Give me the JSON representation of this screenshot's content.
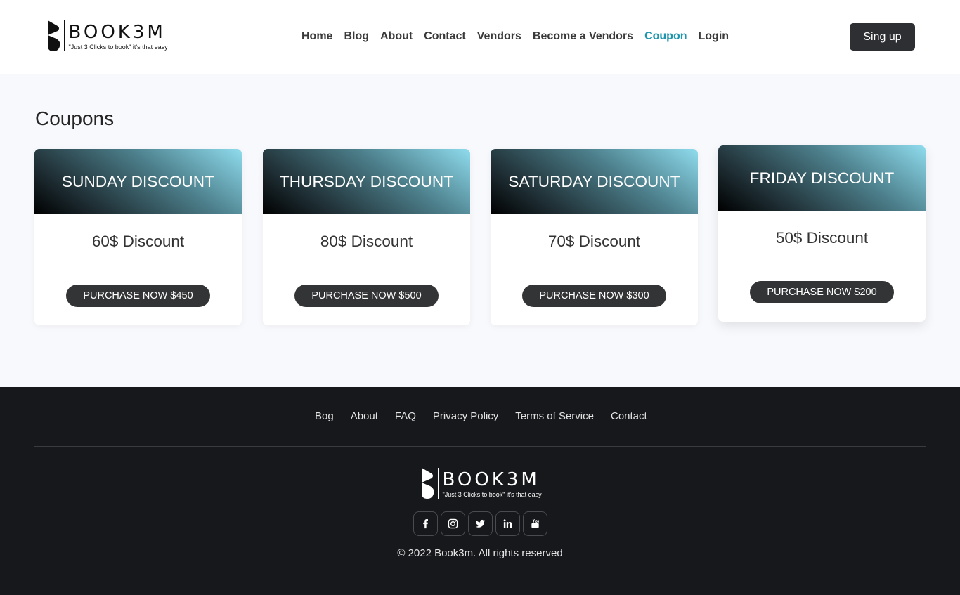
{
  "brand": {
    "name": "BOOK3M",
    "tagline": "\"Just 3 Clicks to book\" it's that easy"
  },
  "nav": {
    "items": [
      {
        "label": "Home"
      },
      {
        "label": "Blog"
      },
      {
        "label": "About"
      },
      {
        "label": "Contact"
      },
      {
        "label": "Vendors"
      },
      {
        "label": "Become a Vendors"
      },
      {
        "label": "Coupon",
        "active": true
      },
      {
        "label": "Login"
      }
    ],
    "signup_label": "Sing up",
    "active_color": "#1e95ad"
  },
  "main": {
    "title": "Coupons",
    "coupons": [
      {
        "name": "SUNDAY DISCOUNT",
        "discount": "60$ Discount",
        "button": "PURCHASE NOW $450"
      },
      {
        "name": "THURSDAY DISCOUNT",
        "discount": "80$ Discount",
        "button": "PURCHASE NOW $500"
      },
      {
        "name": "SATURDAY DISCOUNT",
        "discount": "70$ Discount",
        "button": "PURCHASE NOW $300"
      },
      {
        "name": "FRIDAY DISCOUNT",
        "discount": "50$ Discount",
        "button": "PURCHASE NOW $200"
      }
    ]
  },
  "footer": {
    "links": [
      {
        "label": "Bog"
      },
      {
        "label": "About"
      },
      {
        "label": "FAQ"
      },
      {
        "label": "Privacy Policy"
      },
      {
        "label": "Terms of Service"
      },
      {
        "label": "Contact"
      }
    ],
    "social_icons": [
      "facebook-icon",
      "instagram-icon",
      "twitter-icon",
      "linkedin-icon",
      "youtube-icon"
    ],
    "copyright": "© 2022 Book3m. All rights reserved"
  }
}
